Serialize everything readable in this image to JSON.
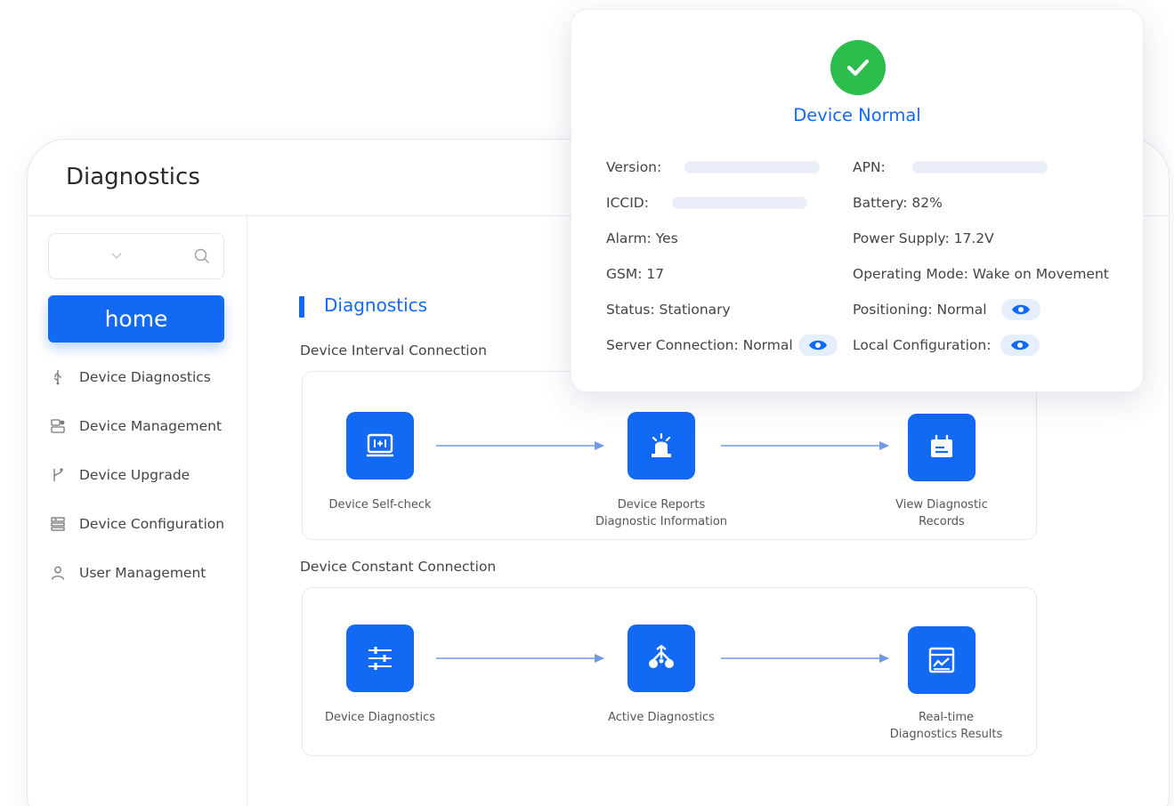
{
  "window": {
    "title": "Diagnostics"
  },
  "sidebar": {
    "home_label": "home",
    "items": [
      {
        "label": "Device Diagnostics",
        "icon": "usb-icon"
      },
      {
        "label": "Device Management",
        "icon": "device-manage-icon"
      },
      {
        "label": "Device Upgrade",
        "icon": "branch-icon"
      },
      {
        "label": "Device Configuration",
        "icon": "server-config-icon"
      },
      {
        "label": "User Management",
        "icon": "user-icon"
      }
    ]
  },
  "main": {
    "section_title": "Diagnostics",
    "groups": [
      {
        "title": "Device Interval Connection",
        "steps": [
          {
            "label_lines": [
              "Device Self-check"
            ],
            "icon": "self-check-icon"
          },
          {
            "label_lines": [
              "Device Reports",
              "Diagnostic Information"
            ],
            "icon": "alarm-light-icon"
          },
          {
            "label_lines": [
              "View Diagnostic",
              "Records"
            ],
            "icon": "records-icon"
          }
        ]
      },
      {
        "title": "Device Constant Connection",
        "steps": [
          {
            "label_lines": [
              "Device Diagnostics"
            ],
            "icon": "sliders-icon"
          },
          {
            "label_lines": [
              "Active Diagnostics"
            ],
            "icon": "network-icon"
          },
          {
            "label_lines": [
              "Real-time",
              "Diagnostics Results"
            ],
            "icon": "chart-window-icon"
          }
        ]
      }
    ]
  },
  "popup": {
    "status": "Device Normal",
    "left_fields": {
      "version": "Version:",
      "iccid": "ICCID:",
      "alarm": "Alarm: Yes",
      "gsm": "GSM: 17",
      "status": "Status: Stationary",
      "server": "Server Connection: Normal"
    },
    "right_fields": {
      "apn": "APN:",
      "battery": "Battery: 82%",
      "power": "Power Supply: 17.2V",
      "mode": "Operating Mode: Wake on Movement",
      "positioning": "Positioning: Normal",
      "local_config": "Local Configuration:"
    }
  },
  "colors": {
    "accent": "#1269f4",
    "success": "#2cbd4d"
  }
}
